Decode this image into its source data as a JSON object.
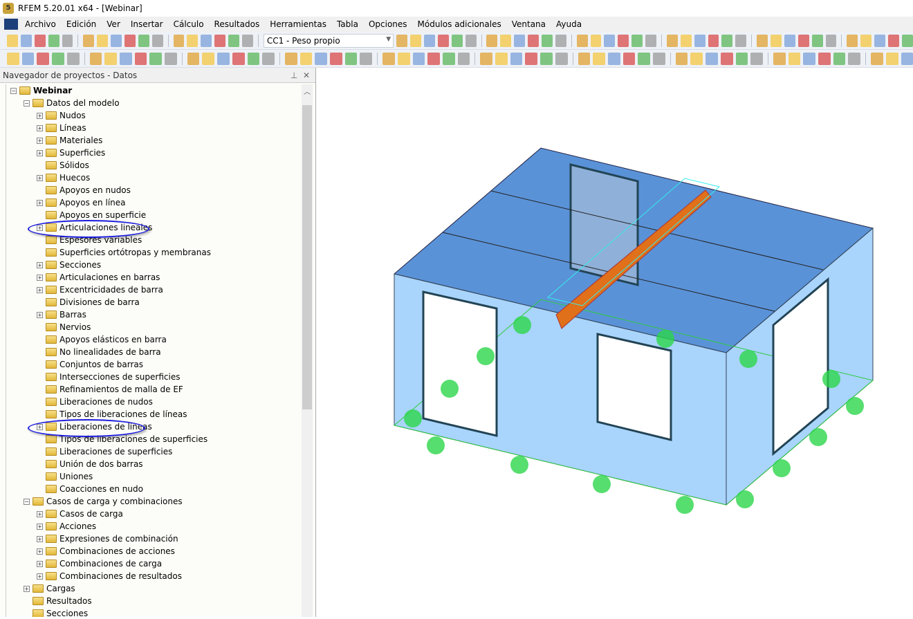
{
  "window": {
    "title": "RFEM 5.20.01 x64 - [Webinar]"
  },
  "menu": [
    "Archivo",
    "Edición",
    "Ver",
    "Insertar",
    "Cálculo",
    "Resultados",
    "Herramientas",
    "Tabla",
    "Opciones",
    "Módulos adicionales",
    "Ventana",
    "Ayuda"
  ],
  "toolbar": {
    "load_case": "CC1 - Peso propio"
  },
  "navigator": {
    "title": "Navegador de proyectos - Datos",
    "tree": [
      {
        "label": "Webinar",
        "level": 0,
        "exp": "-",
        "root": true
      },
      {
        "label": "Datos del modelo",
        "level": 1,
        "exp": "-"
      },
      {
        "label": "Nudos",
        "level": 2,
        "exp": "+"
      },
      {
        "label": "Líneas",
        "level": 2,
        "exp": "+"
      },
      {
        "label": "Materiales",
        "level": 2,
        "exp": "+"
      },
      {
        "label": "Superficies",
        "level": 2,
        "exp": "+"
      },
      {
        "label": "Sólidos",
        "level": 2,
        "exp": ""
      },
      {
        "label": "Huecos",
        "level": 2,
        "exp": "+"
      },
      {
        "label": "Apoyos en nudos",
        "level": 2,
        "exp": ""
      },
      {
        "label": "Apoyos en línea",
        "level": 2,
        "exp": "+"
      },
      {
        "label": "Apoyos en superficie",
        "level": 2,
        "exp": ""
      },
      {
        "label": "Articulaciones lineales",
        "level": 2,
        "exp": "+",
        "highlight": true
      },
      {
        "label": "Espesores variables",
        "level": 2,
        "exp": ""
      },
      {
        "label": "Superficies ortótropas y membranas",
        "level": 2,
        "exp": ""
      },
      {
        "label": "Secciones",
        "level": 2,
        "exp": "+"
      },
      {
        "label": "Articulaciones en barras",
        "level": 2,
        "exp": "+"
      },
      {
        "label": "Excentricidades de barra",
        "level": 2,
        "exp": "+"
      },
      {
        "label": "Divisiones de barra",
        "level": 2,
        "exp": ""
      },
      {
        "label": "Barras",
        "level": 2,
        "exp": "+"
      },
      {
        "label": "Nervios",
        "level": 2,
        "exp": ""
      },
      {
        "label": "Apoyos elásticos en barra",
        "level": 2,
        "exp": ""
      },
      {
        "label": "No linealidades de barra",
        "level": 2,
        "exp": ""
      },
      {
        "label": "Conjuntos de barras",
        "level": 2,
        "exp": ""
      },
      {
        "label": "Intersecciones de superficies",
        "level": 2,
        "exp": ""
      },
      {
        "label": "Refinamientos de malla de EF",
        "level": 2,
        "exp": ""
      },
      {
        "label": "Liberaciones de nudos",
        "level": 2,
        "exp": ""
      },
      {
        "label": "Tipos de liberaciones de líneas",
        "level": 2,
        "exp": ""
      },
      {
        "label": "Liberaciones de líneas",
        "level": 2,
        "exp": "+",
        "highlight": true
      },
      {
        "label": "Tipos de liberaciones de superficies",
        "level": 2,
        "exp": ""
      },
      {
        "label": "Liberaciones de superficies",
        "level": 2,
        "exp": ""
      },
      {
        "label": "Unión de dos barras",
        "level": 2,
        "exp": ""
      },
      {
        "label": "Uniones",
        "level": 2,
        "exp": ""
      },
      {
        "label": "Coacciones en nudo",
        "level": 2,
        "exp": ""
      },
      {
        "label": "Casos de carga y combinaciones",
        "level": 1,
        "exp": "-"
      },
      {
        "label": "Casos de carga",
        "level": 2,
        "exp": "+"
      },
      {
        "label": "Acciones",
        "level": 2,
        "exp": "+"
      },
      {
        "label": "Expresiones de combinación",
        "level": 2,
        "exp": "+"
      },
      {
        "label": "Combinaciones de acciones",
        "level": 2,
        "exp": "+"
      },
      {
        "label": "Combinaciones de carga",
        "level": 2,
        "exp": "+"
      },
      {
        "label": "Combinaciones de resultados",
        "level": 2,
        "exp": "+"
      },
      {
        "label": "Cargas",
        "level": 1,
        "exp": "+"
      },
      {
        "label": "Resultados",
        "level": 1,
        "exp": ""
      },
      {
        "label": "Secciones",
        "level": 1,
        "exp": ""
      }
    ]
  }
}
